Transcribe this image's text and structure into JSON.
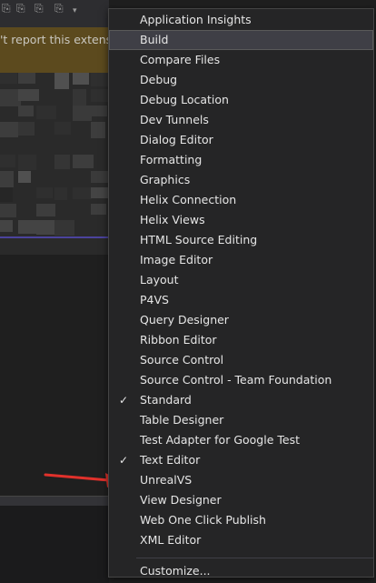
{
  "background": {
    "banner_text": "'t report this extensio",
    "accent_line_color": "#5a4fcf",
    "banner_color": "#5c4a1e"
  },
  "toolbar_icons": [
    "bookmark-icon",
    "bookmark-icon",
    "bookmark-icon",
    "bookmark-icon",
    "overflow-icon"
  ],
  "menu": {
    "items": [
      {
        "label": "Application Insights",
        "checked": false,
        "highlighted": false
      },
      {
        "label": "Build",
        "checked": false,
        "highlighted": true
      },
      {
        "label": "Compare Files",
        "checked": false,
        "highlighted": false
      },
      {
        "label": "Debug",
        "checked": false,
        "highlighted": false
      },
      {
        "label": "Debug Location",
        "checked": false,
        "highlighted": false
      },
      {
        "label": "Dev Tunnels",
        "checked": false,
        "highlighted": false
      },
      {
        "label": "Dialog Editor",
        "checked": false,
        "highlighted": false
      },
      {
        "label": "Formatting",
        "checked": false,
        "highlighted": false
      },
      {
        "label": "Graphics",
        "checked": false,
        "highlighted": false
      },
      {
        "label": "Helix Connection",
        "checked": false,
        "highlighted": false
      },
      {
        "label": "Helix Views",
        "checked": false,
        "highlighted": false
      },
      {
        "label": "HTML Source Editing",
        "checked": false,
        "highlighted": false
      },
      {
        "label": "Image Editor",
        "checked": false,
        "highlighted": false
      },
      {
        "label": "Layout",
        "checked": false,
        "highlighted": false
      },
      {
        "label": "P4VS",
        "checked": false,
        "highlighted": false
      },
      {
        "label": "Query Designer",
        "checked": false,
        "highlighted": false
      },
      {
        "label": "Ribbon Editor",
        "checked": false,
        "highlighted": false
      },
      {
        "label": "Source Control",
        "checked": false,
        "highlighted": false
      },
      {
        "label": "Source Control - Team Foundation",
        "checked": false,
        "highlighted": false
      },
      {
        "label": "Standard",
        "checked": true,
        "highlighted": false
      },
      {
        "label": "Table Designer",
        "checked": false,
        "highlighted": false
      },
      {
        "label": "Test Adapter for Google Test",
        "checked": false,
        "highlighted": false
      },
      {
        "label": "Text Editor",
        "checked": true,
        "highlighted": false
      },
      {
        "label": "UnrealVS",
        "checked": false,
        "highlighted": false
      },
      {
        "label": "View Designer",
        "checked": false,
        "highlighted": false
      },
      {
        "label": "Web One Click Publish",
        "checked": false,
        "highlighted": false
      },
      {
        "label": "XML Editor",
        "checked": false,
        "highlighted": false
      }
    ],
    "customize_label": "Customize...",
    "check_glyph": "✓"
  },
  "annotation": {
    "arrow_color": "#e0312b",
    "points_to": "UnrealVS"
  }
}
